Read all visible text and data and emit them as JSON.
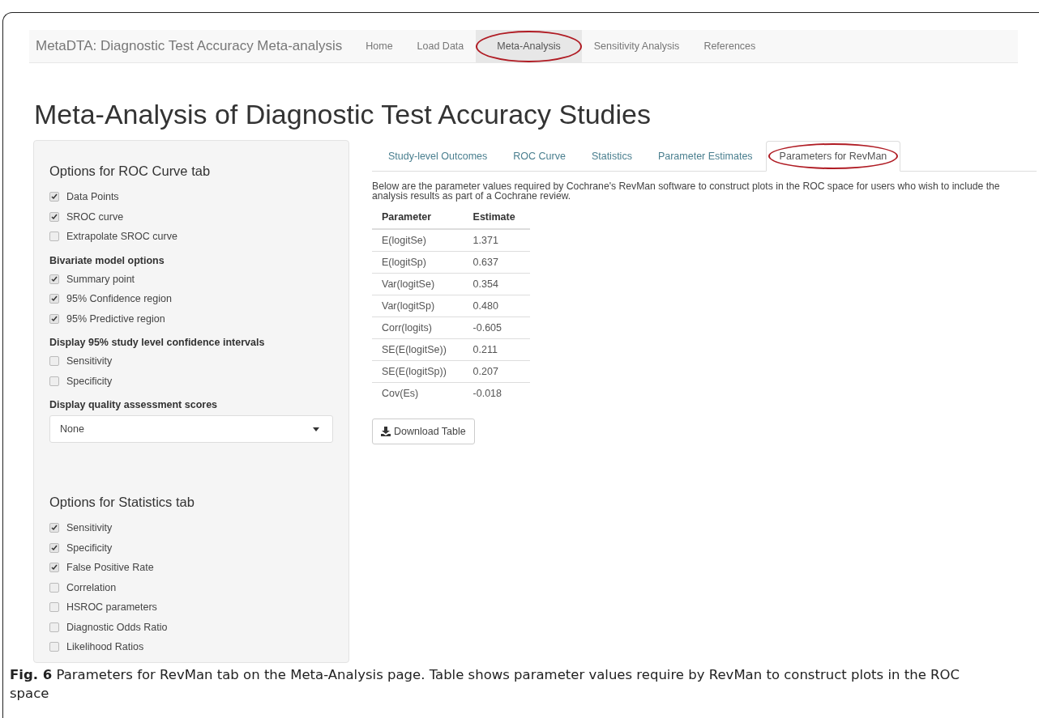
{
  "navbar": {
    "brand": "MetaDTA: Diagnostic Test Accuracy Meta-analysis",
    "items": [
      {
        "label": "Home",
        "selected": false,
        "circled": false
      },
      {
        "label": "Load Data",
        "selected": false,
        "circled": false
      },
      {
        "label": "Meta-Analysis",
        "selected": true,
        "circled": true
      },
      {
        "label": "Sensitivity Analysis",
        "selected": false,
        "circled": false
      },
      {
        "label": "References",
        "selected": false,
        "circled": false
      }
    ]
  },
  "page_title": "Meta-Analysis of Diagnostic Test Accuracy Studies",
  "sidebar": {
    "items": [
      {
        "kind": "section",
        "text": "Options for ROC Curve tab"
      },
      {
        "kind": "checkbox",
        "text": "Data Points",
        "checked": true
      },
      {
        "kind": "checkbox",
        "text": "SROC curve",
        "checked": true
      },
      {
        "kind": "checkbox",
        "text": "Extrapolate SROC curve",
        "checked": false
      },
      {
        "kind": "heading",
        "text": "Bivariate model options"
      },
      {
        "kind": "checkbox",
        "text": "Summary point",
        "checked": true
      },
      {
        "kind": "checkbox",
        "text": "95% Confidence region",
        "checked": true
      },
      {
        "kind": "checkbox",
        "text": "95% Predictive region",
        "checked": true
      },
      {
        "kind": "heading",
        "text": "Display 95% study level confidence intervals"
      },
      {
        "kind": "checkbox",
        "text": "Sensitivity",
        "checked": false
      },
      {
        "kind": "checkbox",
        "text": "Specificity",
        "checked": false
      },
      {
        "kind": "heading",
        "text": "Display quality assessment scores"
      },
      {
        "kind": "select",
        "text": "None"
      },
      {
        "kind": "section",
        "text": "Options for Statistics tab"
      },
      {
        "kind": "checkbox",
        "text": "Sensitivity",
        "checked": true
      },
      {
        "kind": "checkbox",
        "text": "Specificity",
        "checked": true
      },
      {
        "kind": "checkbox",
        "text": "False Positive Rate",
        "checked": true
      },
      {
        "kind": "checkbox",
        "text": "Correlation",
        "checked": false
      },
      {
        "kind": "checkbox",
        "text": "HSROC parameters",
        "checked": false
      },
      {
        "kind": "checkbox",
        "text": "Diagnostic Odds Ratio",
        "checked": false
      },
      {
        "kind": "checkbox",
        "text": "Likelihood Ratios",
        "checked": false
      }
    ]
  },
  "tabs": [
    {
      "label": "Study-level Outcomes",
      "selected": false,
      "circled": false
    },
    {
      "label": "ROC Curve",
      "selected": false,
      "circled": false
    },
    {
      "label": "Statistics",
      "selected": false,
      "circled": false
    },
    {
      "label": "Parameter Estimates",
      "selected": false,
      "circled": false
    },
    {
      "label": "Parameters for RevMan",
      "selected": true,
      "circled": true
    }
  ],
  "description": "Below are the parameter values required by Cochrane's RevMan software to construct plots in the ROC space for users who wish to include the analysis results as part of a Cochrane review.",
  "table": {
    "columns": [
      "Parameter",
      "Estimate"
    ],
    "rows": [
      [
        "E(logitSe)",
        "1.371"
      ],
      [
        "E(logitSp)",
        "0.637"
      ],
      [
        "Var(logitSe)",
        "0.354"
      ],
      [
        "Var(logitSp)",
        "0.480"
      ],
      [
        "Corr(logits)",
        "-0.605"
      ],
      [
        "SE(E(logitSe))",
        "0.211"
      ],
      [
        "SE(E(logitSp))",
        "0.207"
      ],
      [
        "Cov(Es)",
        "-0.018"
      ]
    ]
  },
  "download_button": "Download Table",
  "caption": "**Fig. 6** Parameters for RevMan tab on the Meta-Analysis page. Table shows parameter values require by RevMan to construct plots in the ROC space"
}
